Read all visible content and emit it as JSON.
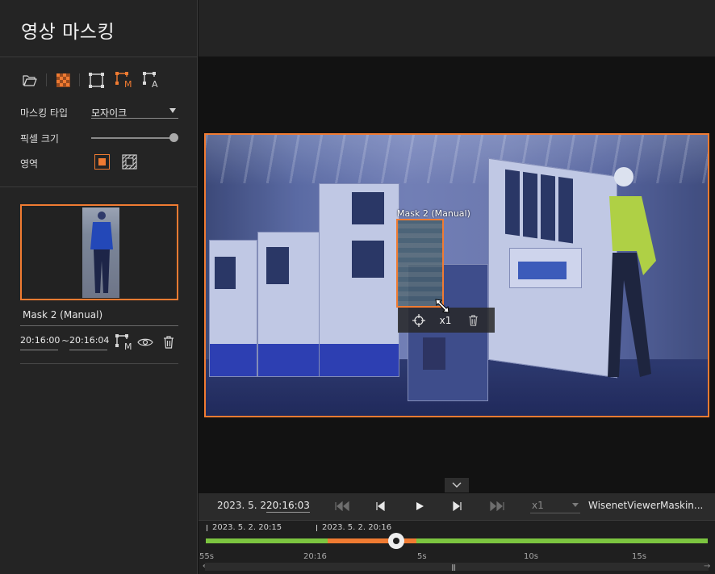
{
  "app": {
    "title": "영상 마스킹"
  },
  "toolbar": {
    "icons": [
      "folder-open-icon",
      "mosaic-icon",
      "mask-rect-icon",
      "manual-mask-icon",
      "auto-mask-icon"
    ],
    "manual_letter": "M",
    "auto_letter": "A"
  },
  "settings": {
    "mask_type_label": "마스킹 타입",
    "mask_type_value": "모자이크",
    "pixel_size_label": "픽셀 크기",
    "pixel_size_level": 1.0,
    "area_label": "영역"
  },
  "mask_item": {
    "name": "Mask 2 (Manual)",
    "start_time": "20:16:00",
    "separator": "~",
    "end_time": "20:16:04",
    "manual_letter": "M"
  },
  "viewer": {
    "mask_label": "Mask 2 (Manual)",
    "speed_badge": "x1"
  },
  "controls": {
    "date": "2023. 5. 2.",
    "time": "20:16:03",
    "speed": "x1",
    "filename": "WisenetViewerMaskin..."
  },
  "timeline": {
    "markers": [
      "2023. 5. 2. 20:15",
      "2023. 5. 2. 20:16"
    ],
    "scale_labels": [
      "55s",
      "20:16",
      "5s",
      "10s",
      "15s"
    ],
    "left_arrow": "←",
    "right_arrow": "→",
    "grip": "|||"
  },
  "colors": {
    "accent": "#f07b32",
    "green": "#7cc540",
    "panel": "#242424"
  }
}
